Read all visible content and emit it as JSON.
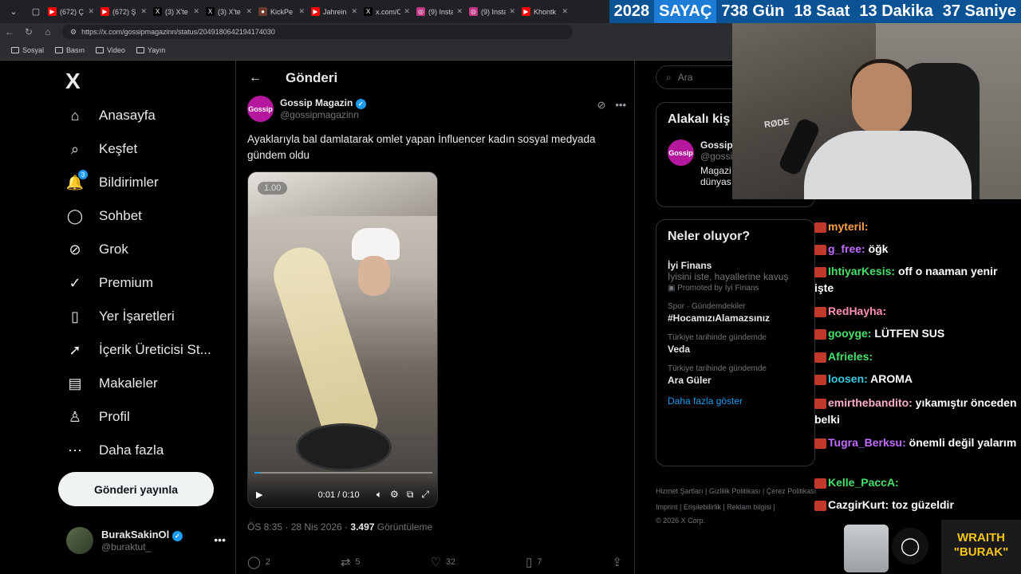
{
  "browser": {
    "tabs": [
      {
        "title": "(672) Ç",
        "color": "#ff0000",
        "glyph": "▶"
      },
      {
        "title": "(672) Ş",
        "color": "#ff0000",
        "glyph": "▶"
      },
      {
        "title": "(3) X'te",
        "color": "#000000",
        "glyph": "X"
      },
      {
        "title": "(3) X'te",
        "color": "#000000",
        "glyph": "X"
      },
      {
        "title": "KickPe",
        "color": "#6b3a2e",
        "glyph": "●"
      },
      {
        "title": "Jahrein",
        "color": "#ff0000",
        "glyph": "▶"
      },
      {
        "title": "x.com/C",
        "color": "#000000",
        "glyph": "X"
      },
      {
        "title": "(9) Insta",
        "color": "#c13584",
        "glyph": "◎"
      },
      {
        "title": "(9) Insta",
        "color": "#c13584",
        "glyph": "◎"
      },
      {
        "title": "Khontk",
        "color": "#ff0000",
        "glyph": "▶"
      }
    ],
    "url": "https://x.com/gossipmagazinn/status/2049180642194174030",
    "bookmarks": [
      "Sosyal",
      "Basın",
      "Video",
      "Yayın"
    ]
  },
  "counter": {
    "year": "2028",
    "label": "SAYAÇ",
    "days": "738 Gün",
    "hours": "18 Saat",
    "minutes": "13 Dakika",
    "seconds": "37 Saniye"
  },
  "sidebar": {
    "logo": "X",
    "items": [
      {
        "label": "Anasayfa",
        "icon": "home-icon",
        "glyph": "⌂"
      },
      {
        "label": "Keşfet",
        "icon": "search-icon",
        "glyph": "⌕"
      },
      {
        "label": "Bildirimler",
        "icon": "bell-icon",
        "glyph": "🔔",
        "badge": "3"
      },
      {
        "label": "Sohbet",
        "icon": "chat-icon",
        "glyph": "◯"
      },
      {
        "label": "Grok",
        "icon": "grok-icon",
        "glyph": "⊘"
      },
      {
        "label": "Premium",
        "icon": "premium-icon",
        "glyph": "✓"
      },
      {
        "label": "Yer İşaretleri",
        "icon": "bookmark-icon",
        "glyph": "▯"
      },
      {
        "label": "İçerik Üreticisi St...",
        "icon": "rocket-icon",
        "glyph": "➚"
      },
      {
        "label": "Makaleler",
        "icon": "article-icon",
        "glyph": "▤"
      },
      {
        "label": "Profil",
        "icon": "profile-icon",
        "glyph": "♙"
      },
      {
        "label": "Daha fazla",
        "icon": "more-icon",
        "glyph": "⋯"
      }
    ],
    "post_button": "Gönderi yayınla",
    "user": {
      "name": "BurakSakinOl",
      "handle": "@buraktut_"
    }
  },
  "main": {
    "header_title": "Gönderi",
    "tweet": {
      "avatar_text": "Gossip",
      "author": "Gossip Magazin",
      "handle": "@gossipmagazinn",
      "text": "Ayaklarıyla bal damlatarak omlet yapan İnfluencer kadın sosyal medyada gündem oldu",
      "video": {
        "speed": "1.00",
        "time": "0:01 / 0:10",
        "progress": 0.03
      },
      "date": "ÖS 8:35 · 28 Nis 2026 · ",
      "views": "3.497",
      "views_label": " Görüntüleme",
      "replies": "2",
      "retweets": "5",
      "likes": "32",
      "bookmarks": "7"
    }
  },
  "right": {
    "search_placeholder": "Ara",
    "related": {
      "title": "Alakalı kiş",
      "name": "Gossip",
      "handle": "@gossi",
      "bio1": "Magazi",
      "bio2": "dünyas"
    },
    "trends_title": "Neler oluyor?",
    "promo": {
      "name": "İyi Finans",
      "sub": "İyisini iste, hayallerine kavuş",
      "promoted": "Promoted by İyi Finans"
    },
    "trends": [
      {
        "cat": "Spor · Gündemdekiler",
        "val": "#HocamızıAlamazsınız"
      },
      {
        "cat": "Türkiye tarihinde gündemde",
        "val": "Veda"
      },
      {
        "cat": "Türkiye tarihinde gündemde",
        "val": "Ara Güler"
      }
    ],
    "show_more": "Daha fazla göster",
    "footer1": "Hizmet Şartları  |  Gizlilik Politikası  |  Çerez Politikası",
    "footer2": "Imprint  |  Erişilebilirlik  |  Reklam bilgisi  |",
    "footer3": "© 2026 X Corp."
  },
  "chat": [
    {
      "user": "myteril:",
      "color": "#ff9f43",
      "text": ""
    },
    {
      "user": "g_free:",
      "color": "#c06cff",
      "text": "öğk"
    },
    {
      "user": "IhtiyarKesis:",
      "color": "#48e06b",
      "text": "off o naaman yenir işte"
    },
    {
      "user": "RedHayha:",
      "color": "#ff8fb1",
      "text": ""
    },
    {
      "user": "gooyge:",
      "color": "#48e06b",
      "text": "LÜTFEN SUS"
    },
    {
      "user": "Afrieles:",
      "color": "#48e06b",
      "text": ""
    },
    {
      "user": "loosen:",
      "color": "#36c9e0",
      "text": "AROMA"
    },
    {
      "user": "emirthebandito:",
      "color": "#ffb0c8",
      "text": "yıkamıştır önceden belki"
    },
    {
      "user": "Tugra_Berksu:",
      "color": "#c06cff",
      "text": "önemli değil yalarım"
    },
    {
      "user": "Kelle_PaccA:",
      "color": "#48e06b",
      "text": ""
    },
    {
      "user": "CazgirKurt:",
      "color": "#ffffff",
      "text": "toz güzeldir"
    }
  ],
  "overlay": {
    "brand1": "WRAITH",
    "brand2": "\"BURAK\"",
    "webcam_text": "RØDE"
  }
}
